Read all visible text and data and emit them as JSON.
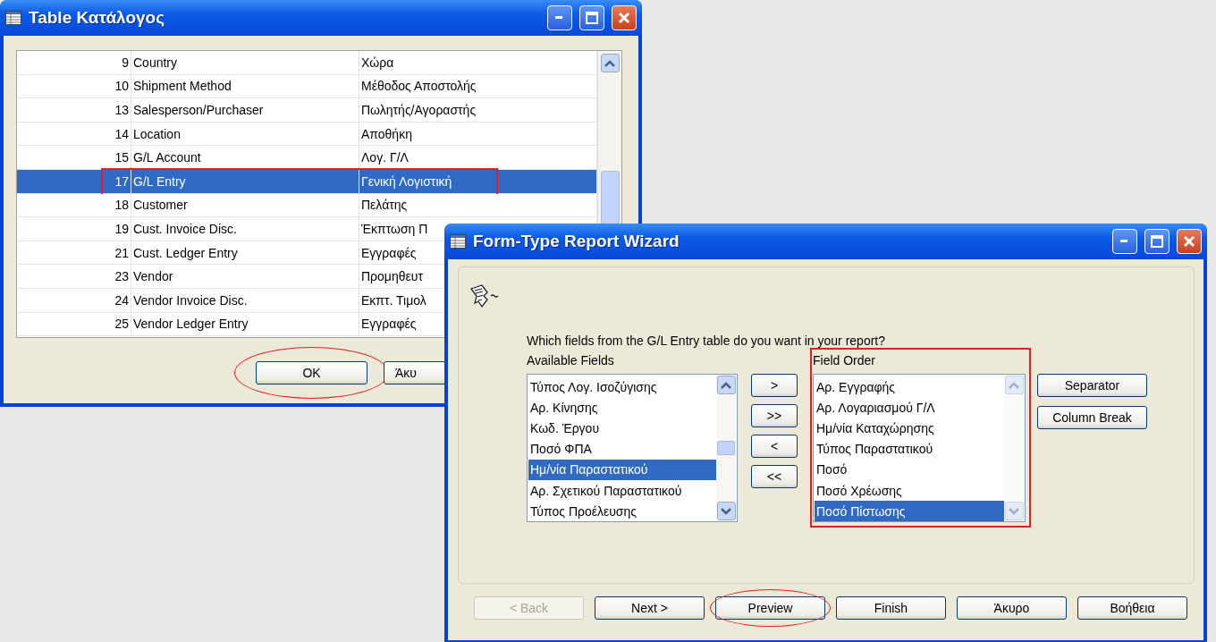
{
  "table_window": {
    "title": "Table Κατάλογος",
    "rows": [
      {
        "number": "9",
        "name": "Country",
        "caption": "Χώρα",
        "selected": false,
        "marked": false
      },
      {
        "number": "10",
        "name": "Shipment Method",
        "caption": "Μέθοδος Αποστολής",
        "selected": false,
        "marked": false
      },
      {
        "number": "13",
        "name": "Salesperson/Purchaser",
        "caption": "Πωλητής/Αγοραστής",
        "selected": false,
        "marked": false
      },
      {
        "number": "14",
        "name": "Location",
        "caption": "Αποθήκη",
        "selected": false,
        "marked": false
      },
      {
        "number": "15",
        "name": "G/L Account",
        "caption": "Λογ. Γ/Λ",
        "selected": false,
        "marked": false
      },
      {
        "number": "17",
        "name": "G/L Entry",
        "caption": "Γενική Λογιστική",
        "selected": true,
        "marked": true
      },
      {
        "number": "18",
        "name": "Customer",
        "caption": "Πελάτης",
        "selected": false,
        "marked": false
      },
      {
        "number": "19",
        "name": "Cust. Invoice Disc.",
        "caption": "Έκπτωση Π",
        "selected": false,
        "marked": false
      },
      {
        "number": "21",
        "name": "Cust. Ledger Entry",
        "caption": "Εγγραφές",
        "selected": false,
        "marked": false
      },
      {
        "number": "23",
        "name": "Vendor",
        "caption": "Προμηθευτ",
        "selected": false,
        "marked": false
      },
      {
        "number": "24",
        "name": "Vendor Invoice Disc.",
        "caption": "Εκπτ. Τιμολ",
        "selected": false,
        "marked": false
      },
      {
        "number": "25",
        "name": "Vendor Ledger Entry",
        "caption": "Εγγραφές",
        "selected": false,
        "marked": false
      }
    ],
    "buttons": [
      {
        "label": "OK",
        "circled": true
      },
      {
        "label": "Άκυ",
        "circled": false
      }
    ]
  },
  "wizard": {
    "title": "Form-Type Report Wizard",
    "question": "Which fields from the G/L Entry table do you want in your report?",
    "available_fields": {
      "label": "Available Fields",
      "items": [
        {
          "text": "Τύπος Λογ. Ισοζύγισης",
          "selected": false
        },
        {
          "text": "Αρ. Κίνησης",
          "selected": false
        },
        {
          "text": "Κωδ. Έργου",
          "selected": false
        },
        {
          "text": "Ποσό ΦΠΑ",
          "selected": false
        },
        {
          "text": "Ημ/νία Παραστατικού",
          "selected": true
        },
        {
          "text": "Αρ. Σχετικού Παραστατικού",
          "selected": false
        },
        {
          "text": "Τύπος Προέλευσης",
          "selected": false
        }
      ]
    },
    "move_buttons": [
      ">",
      ">>",
      "<",
      "<<"
    ],
    "field_order": {
      "label": "Field Order",
      "marked": true,
      "items": [
        {
          "text": "Αρ. Εγγραφής",
          "selected": false
        },
        {
          "text": "Αρ. Λογαριασμού Γ/Λ",
          "selected": false
        },
        {
          "text": "Ημ/νία Καταχώρησης",
          "selected": false
        },
        {
          "text": "Τύπος Παραστατικού",
          "selected": false
        },
        {
          "text": "Ποσό",
          "selected": false
        },
        {
          "text": "Ποσό Χρέωσης",
          "selected": false
        },
        {
          "text": "Ποσό Πίστωσης",
          "selected": true
        }
      ]
    },
    "side_buttons": [
      "Separator",
      "Column Break"
    ],
    "footer_buttons": [
      {
        "label": "< Back",
        "disabled": true,
        "circled": false
      },
      {
        "label": "Next >",
        "disabled": false,
        "circled": false
      },
      {
        "label": "Preview",
        "disabled": false,
        "circled": true
      },
      {
        "label": "Finish",
        "disabled": false,
        "circled": false
      },
      {
        "label": "Άκυρο",
        "disabled": false,
        "circled": false
      },
      {
        "label": "Βοήθεια",
        "disabled": false,
        "circled": false
      }
    ]
  }
}
